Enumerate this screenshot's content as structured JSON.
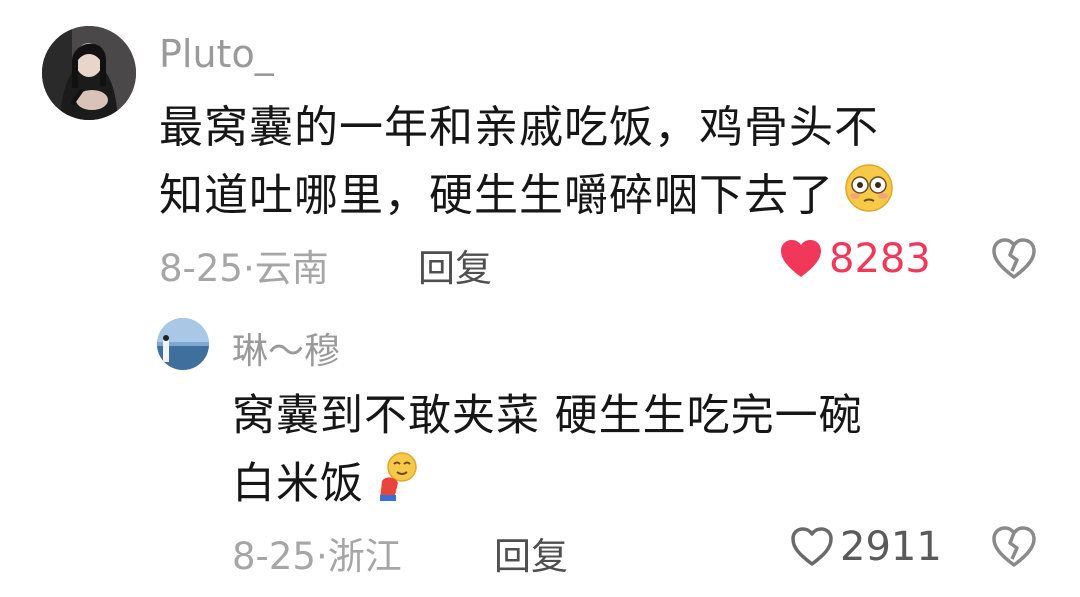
{
  "comment": {
    "username": "Pluto_",
    "text_line1": "最窝囊的一年和亲戚吃饭，鸡骨头不",
    "text_line2": "知道吐哪里，硬生生嚼碎咽下去了",
    "emoji": "flushed-face-emoji",
    "date": "8-25",
    "sep": "·",
    "location": "云南",
    "reply_label": "回复",
    "like_count": "8283",
    "liked": true,
    "like_color": "#f2385a"
  },
  "reply": {
    "username": "琳～穆",
    "text_line1": "窝囊到不敢夹菜 硬生生吃完一碗",
    "text_line2": "白米饭",
    "emoji": "bowing-face-emoji",
    "date": "8-25",
    "sep": "·",
    "location": "浙江",
    "reply_label": "回复",
    "like_count": "2911",
    "liked": false
  }
}
